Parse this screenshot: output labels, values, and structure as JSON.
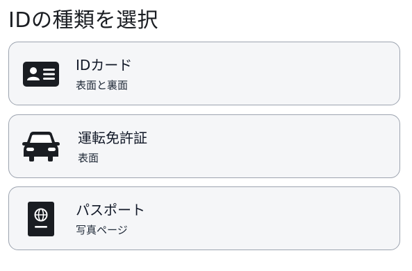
{
  "page": {
    "title": "IDの種類を選択"
  },
  "options": [
    {
      "label": "IDカード",
      "sublabel": "表面と裏面",
      "icon": "id-card-icon"
    },
    {
      "label": "運転免許証",
      "sublabel": "表面",
      "icon": "car-icon"
    },
    {
      "label": "パスポート",
      "sublabel": "写真ページ",
      "icon": "passport-icon"
    }
  ],
  "colors": {
    "card_background": "#f5f6f8",
    "card_border": "#9ca3af",
    "icon": "#1a1d22",
    "text": "#111827"
  }
}
